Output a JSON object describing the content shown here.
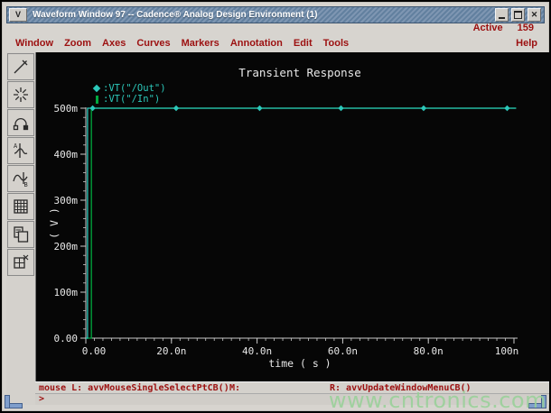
{
  "window": {
    "title": "Waveform Window 97 -- Cadence® Analog Design Environment (1)",
    "menu_glyph": "V"
  },
  "active_row": {
    "label": "Active",
    "value": "159"
  },
  "menubar": {
    "items": [
      "Window",
      "Zoom",
      "Axes",
      "Curves",
      "Markers",
      "Annotation",
      "Edit",
      "Tools"
    ],
    "help": "Help"
  },
  "toolbar_icons": [
    "pen-icon",
    "asterisk-zoom-icon",
    "arc-probe-icon",
    "marker-a-icon",
    "marker-b-icon",
    "calculator-icon",
    "copy-icon",
    "cut-window-icon"
  ],
  "chart_data": {
    "type": "line",
    "title": "Transient Response",
    "xlabel": "time ( s )",
    "ylabel": "( V )",
    "xlim": [
      0,
      100
    ],
    "x_unit": "ns",
    "ylim": [
      0,
      500
    ],
    "y_unit": "mV",
    "grid": false,
    "legend_position": "top-left",
    "x_tick_vals": [
      0,
      20,
      40,
      60,
      80,
      100
    ],
    "x_tick_labels": [
      "0.00",
      "20.0n",
      "40.0n",
      "60.0n",
      "80.0n",
      "100n"
    ],
    "y_tick_vals": [
      0,
      100,
      200,
      300,
      400,
      500
    ],
    "y_tick_labels": [
      "0.00",
      "100m",
      "200m",
      "300m",
      "400m",
      "500m"
    ],
    "x_minor_step": 2,
    "y_minor_step": 20,
    "legend_separator": ": ",
    "series": [
      {
        "name": "VT(\"/Out\")",
        "color": "#2cc8ba",
        "marker": "diamond",
        "points": [
          [
            0,
            0
          ],
          [
            0.4,
            0
          ],
          [
            0.4,
            500
          ],
          [
            100.5,
            500
          ]
        ],
        "marker_x": [
          1.6,
          21.1,
          40.6,
          59.6,
          78.9,
          98.4
        ],
        "marker_y": 500
      },
      {
        "name": "VT(\"/In\")",
        "color": "#00a83e",
        "marker": "vbar",
        "points": [
          [
            0,
            0
          ],
          [
            1.3,
            0
          ],
          [
            1.3,
            500
          ],
          [
            100.5,
            500
          ]
        ]
      }
    ]
  },
  "statusbar": {
    "mouse_left": "mouse L: avvMouseSingleSelectPtCB()",
    "mouse_middle": "M:",
    "mouse_right": "R: avvUpdateWindowMenuCB()",
    "prompt": ">"
  },
  "watermark": "www.cntronics.com",
  "colors": {
    "titlebar_blue": "#6b87a8",
    "menu_text_red": "#9c1010",
    "canvas_bg": "#060606",
    "axis_gray": "#c9c9c9",
    "plot_text": "#e8e8e8",
    "trace_teal": "#2cc8ba",
    "trace_green": "#00a83e",
    "watermark_green": "#96d096",
    "grip_blue": "#7f9ecc"
  }
}
